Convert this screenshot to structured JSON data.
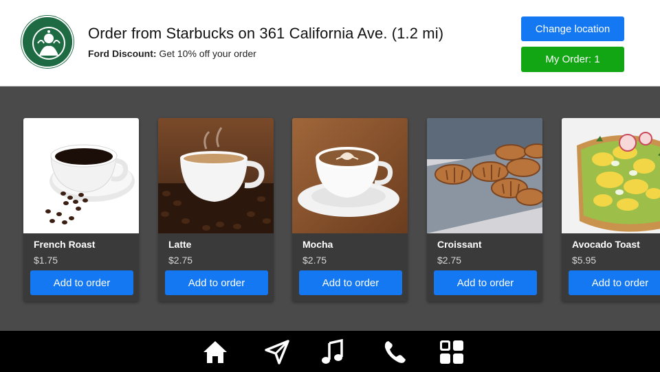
{
  "header": {
    "store_title": "Order from Starbucks on 361 California Ave. (1.2 mi)",
    "discount_label": "Ford Discount:",
    "discount_text": " Get 10% off your order",
    "logo_icon": "starbucks-logo",
    "change_location_label": "Change location",
    "my_order_label": "My Order: 1"
  },
  "colors": {
    "primary_blue": "#1378f2",
    "order_green": "#13a614",
    "content_bg": "#4a4a4a",
    "card_bg": "#3a3a3a",
    "bottom_bar": "#000000"
  },
  "menu": [
    {
      "name": "French Roast",
      "price": "$1.75",
      "button": "Add to order",
      "image": "black-coffee-cup"
    },
    {
      "name": "Latte",
      "price": "$2.75",
      "button": "Add to order",
      "image": "latte-on-beans"
    },
    {
      "name": "Mocha",
      "price": "$2.75",
      "button": "Add to order",
      "image": "mocha-latte-art"
    },
    {
      "name": "Croissant",
      "price": "$2.75",
      "button": "Add to order",
      "image": "croissants-tray"
    },
    {
      "name": "Avocado Toast",
      "price": "$5.95",
      "button": "Add to order",
      "image": "avocado-toast"
    }
  ],
  "bottom_nav": [
    "home-icon",
    "navigation-icon",
    "music-icon",
    "phone-icon",
    "apps-grid-icon"
  ]
}
